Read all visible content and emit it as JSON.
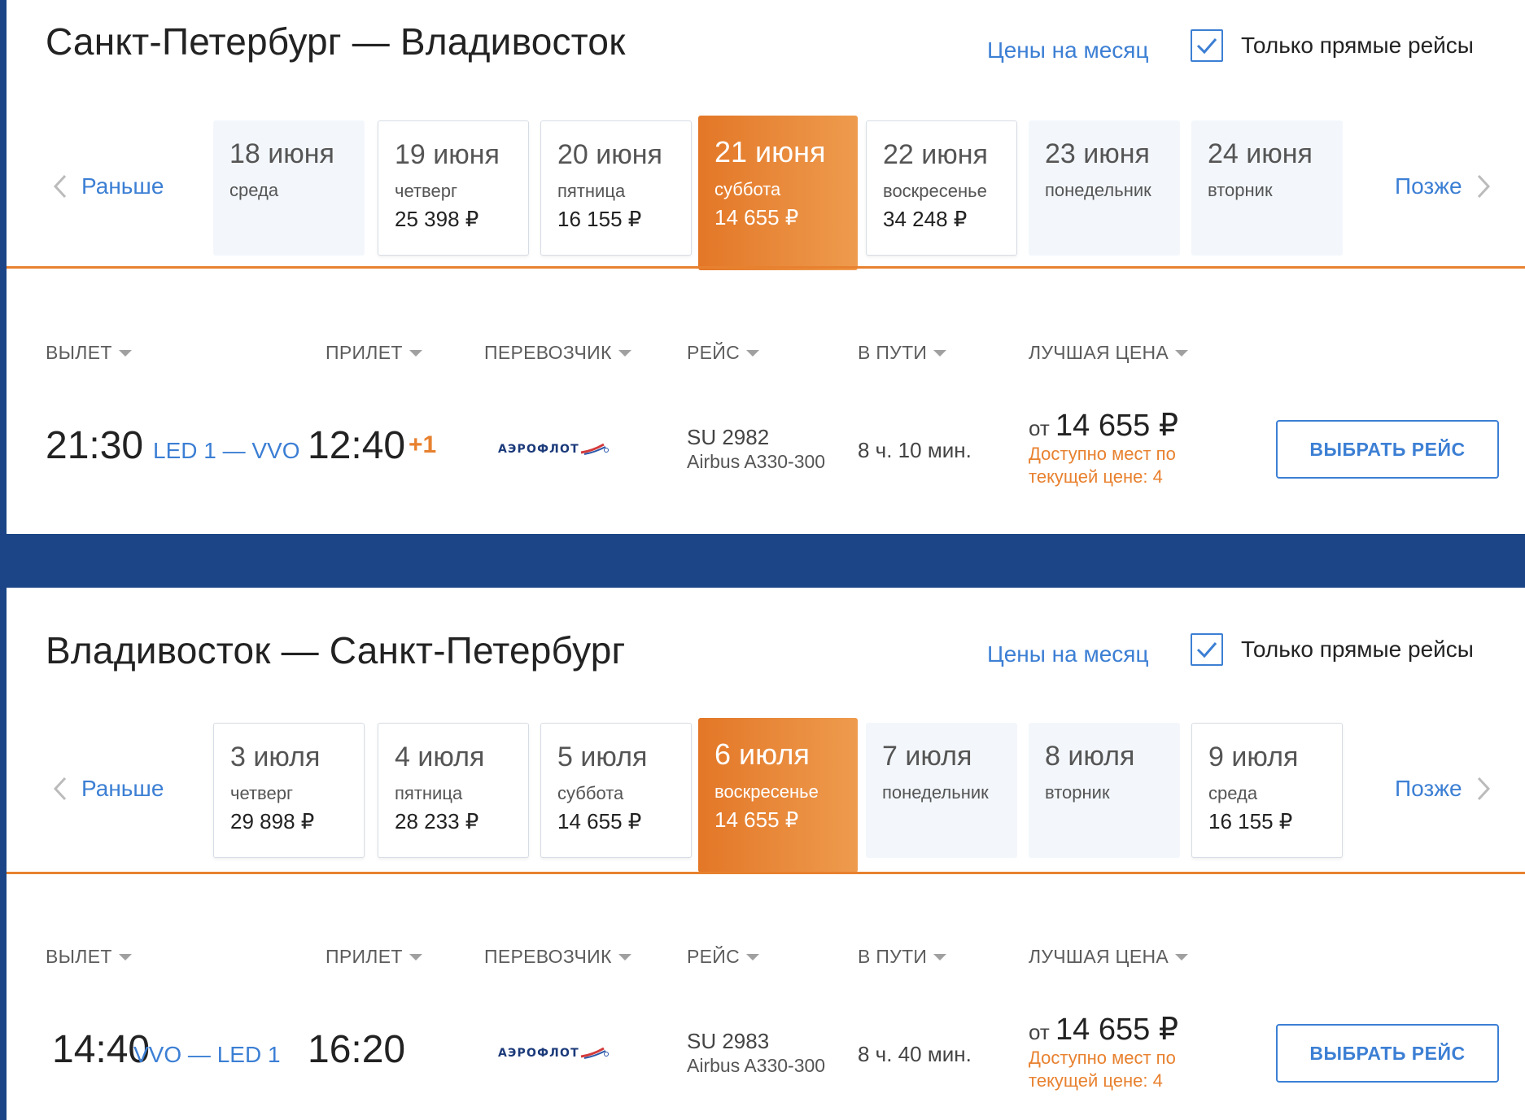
{
  "sections": [
    {
      "title": "Санкт-Петербург — Владивосток",
      "month_link": "Цены на месяц",
      "direct_label": "Только прямые рейсы",
      "nav_prev": "Раньше",
      "nav_next": "Позже",
      "dates": [
        {
          "date": "18 июня",
          "day": "среда",
          "price": "",
          "state": "empty"
        },
        {
          "date": "19 июня",
          "day": "четверг",
          "price": "25 398 ₽",
          "state": "priced"
        },
        {
          "date": "20 июня",
          "day": "пятница",
          "price": "16 155 ₽",
          "state": "priced"
        },
        {
          "date": "21 июня",
          "day": "суббота",
          "price": "14 655 ₽",
          "state": "selected"
        },
        {
          "date": "22 июня",
          "day": "воскресенье",
          "price": "34 248 ₽",
          "state": "priced"
        },
        {
          "date": "23 июня",
          "day": "понедельник",
          "price": "",
          "state": "empty"
        },
        {
          "date": "24 июня",
          "day": "вторник",
          "price": "",
          "state": "empty"
        }
      ],
      "columns": {
        "departure": "ВЫЛЕТ",
        "arrival": "ПРИЛЕТ",
        "carrier": "ПЕРЕВОЗЧИК",
        "flight": "РЕЙС",
        "duration": "В ПУТИ",
        "best_price": "ЛУЧШАЯ ЦЕНА"
      },
      "flight": {
        "dep_time": "21:30",
        "airports": "LED 1 — VVO",
        "arr_time": "12:40",
        "next_day": "+1",
        "carrier": "АЭРОФЛОТ",
        "number": "SU 2982",
        "aircraft": "Airbus A330-300",
        "duration": "8 ч. 10 мин.",
        "price_prefix": "от",
        "price": "14 655 ₽",
        "seats_line1": "Доступно мест по",
        "seats_line2": "текущей цене: 4",
        "button": "ВЫБРАТЬ РЕЙС"
      }
    },
    {
      "title": "Владивосток — Санкт-Петербург",
      "month_link": "Цены на месяц",
      "direct_label": "Только прямые рейсы",
      "nav_prev": "Раньше",
      "nav_next": "Позже",
      "dates": [
        {
          "date": "3 июля",
          "day": "четверг",
          "price": "29 898 ₽",
          "state": "priced"
        },
        {
          "date": "4 июля",
          "day": "пятница",
          "price": "28 233 ₽",
          "state": "priced"
        },
        {
          "date": "5 июля",
          "day": "суббота",
          "price": "14 655 ₽",
          "state": "priced"
        },
        {
          "date": "6 июля",
          "day": "воскресенье",
          "price": "14 655 ₽",
          "state": "selected"
        },
        {
          "date": "7 июля",
          "day": "понедельник",
          "price": "",
          "state": "empty"
        },
        {
          "date": "8 июля",
          "day": "вторник",
          "price": "",
          "state": "empty"
        },
        {
          "date": "9 июля",
          "day": "среда",
          "price": "16 155 ₽",
          "state": "priced"
        }
      ],
      "columns": {
        "departure": "ВЫЛЕТ",
        "arrival": "ПРИЛЕТ",
        "carrier": "ПЕРЕВОЗЧИК",
        "flight": "РЕЙС",
        "duration": "В ПУТИ",
        "best_price": "ЛУЧШАЯ ЦЕНА"
      },
      "flight": {
        "dep_time": "14:40",
        "airports": "VVO — LED 1",
        "arr_time": "16:20",
        "next_day": "",
        "carrier": "АЭРОФЛОТ",
        "number": "SU 2983",
        "aircraft": "Airbus A330-300",
        "duration": "8 ч. 40 мин.",
        "price_prefix": "от",
        "price": "14 655 ₽",
        "seats_line1": "Доступно мест по",
        "seats_line2": "текущей цене: 4",
        "button": "ВЫБРАТЬ РЕЙС"
      }
    }
  ],
  "colors": {
    "accent": "#3c7fd4",
    "orange": "#e8812f",
    "background": "#1b4587"
  },
  "icons": {
    "checkbox": "check-icon",
    "prev": "chevron-left-icon",
    "next": "chevron-right-icon",
    "dropdown": "caret-down-icon",
    "carrier_logo": "aeroflot-logo-icon"
  }
}
